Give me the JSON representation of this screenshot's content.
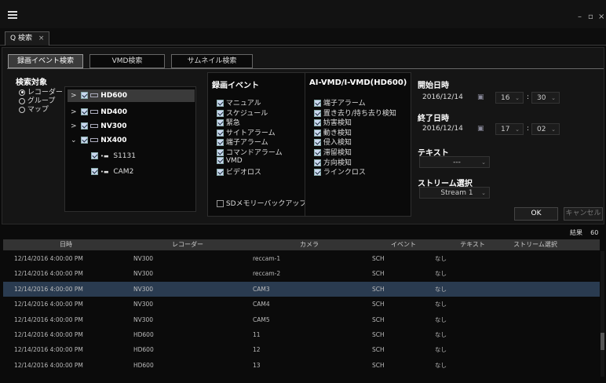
{
  "window": {
    "minimize": "–",
    "maximize": "▫",
    "close": "×"
  },
  "tab": {
    "icon": "Q",
    "label": "検索",
    "close": "×"
  },
  "subtabs": [
    "録画イベント検索",
    "VMD検索",
    "サムネイル検索"
  ],
  "target": {
    "title": "検索対象",
    "radios": [
      {
        "label": "レコーダー",
        "on": true
      },
      {
        "label": "グループ",
        "on": false
      },
      {
        "label": "マップ",
        "on": false
      }
    ]
  },
  "tree": [
    {
      "expander": ">",
      "label": "HD600",
      "bold": true,
      "selected": true
    },
    {
      "expander": ">",
      "label": "ND400",
      "bold": true
    },
    {
      "expander": ">",
      "label": "NV300",
      "bold": true
    },
    {
      "expander": "⌄",
      "label": "NX400",
      "bold": true
    },
    {
      "expander": "",
      "label": "S1131",
      "bold": false
    },
    {
      "expander": "",
      "label": "CAM2",
      "bold": false
    }
  ],
  "rec_events": {
    "title": "録画イベント",
    "items": [
      "マニュアル",
      "スケジュール",
      "緊急",
      "サイトアラーム",
      "端子アラーム",
      "コマンドアラーム",
      "VMD",
      "ビデオロス"
    ],
    "sd": "SDメモリーバックアップ"
  },
  "aivmd": {
    "title": "AI-VMD/I-VMD(HD600)",
    "items": [
      "端子アラーム",
      "置き去り/持ち去り検知",
      "妨害検知",
      "動き検知",
      "侵入検知",
      "滞留検知",
      "方向検知",
      "ラインクロス"
    ]
  },
  "start": {
    "title": "開始日時",
    "date": "2016/12/14",
    "hour": "16",
    "minute": "30"
  },
  "end": {
    "title": "終了日時",
    "date": "2016/12/14",
    "hour": "17",
    "minute": "02"
  },
  "text": {
    "title": "テキスト",
    "value": "---"
  },
  "stream": {
    "title": "ストリーム選択",
    "value": "Stream 1"
  },
  "buttons": {
    "ok": "OK",
    "cancel": "キャンセル"
  },
  "results": {
    "label": "結果",
    "count": "60"
  },
  "table": {
    "headers": [
      "日時",
      "レコーダー",
      "カメラ",
      "イベント",
      "テキスト",
      "ストリーム選択"
    ],
    "rows": [
      [
        "12/14/2016 4:00:00 PM",
        "NV300",
        "reccam-1",
        "SCH",
        "なし"
      ],
      [
        "12/14/2016 4:00:00 PM",
        "NV300",
        "reccam-2",
        "SCH",
        "なし"
      ],
      [
        "12/14/2016 4:00:00 PM",
        "NV300",
        "CAM3",
        "SCH",
        "なし"
      ],
      [
        "12/14/2016 4:00:00 PM",
        "NV300",
        "CAM4",
        "SCH",
        "なし"
      ],
      [
        "12/14/2016 4:00:00 PM",
        "NV300",
        "CAM5",
        "SCH",
        "なし"
      ],
      [
        "12/14/2016 4:00:00 PM",
        "HD600",
        "11",
        "SCH",
        "なし"
      ],
      [
        "12/14/2016 4:00:00 PM",
        "HD600",
        "12",
        "SCH",
        "なし"
      ],
      [
        "12/14/2016 4:00:00 PM",
        "HD600",
        "13",
        "SCH",
        "なし"
      ]
    ],
    "selected_row": 2
  }
}
